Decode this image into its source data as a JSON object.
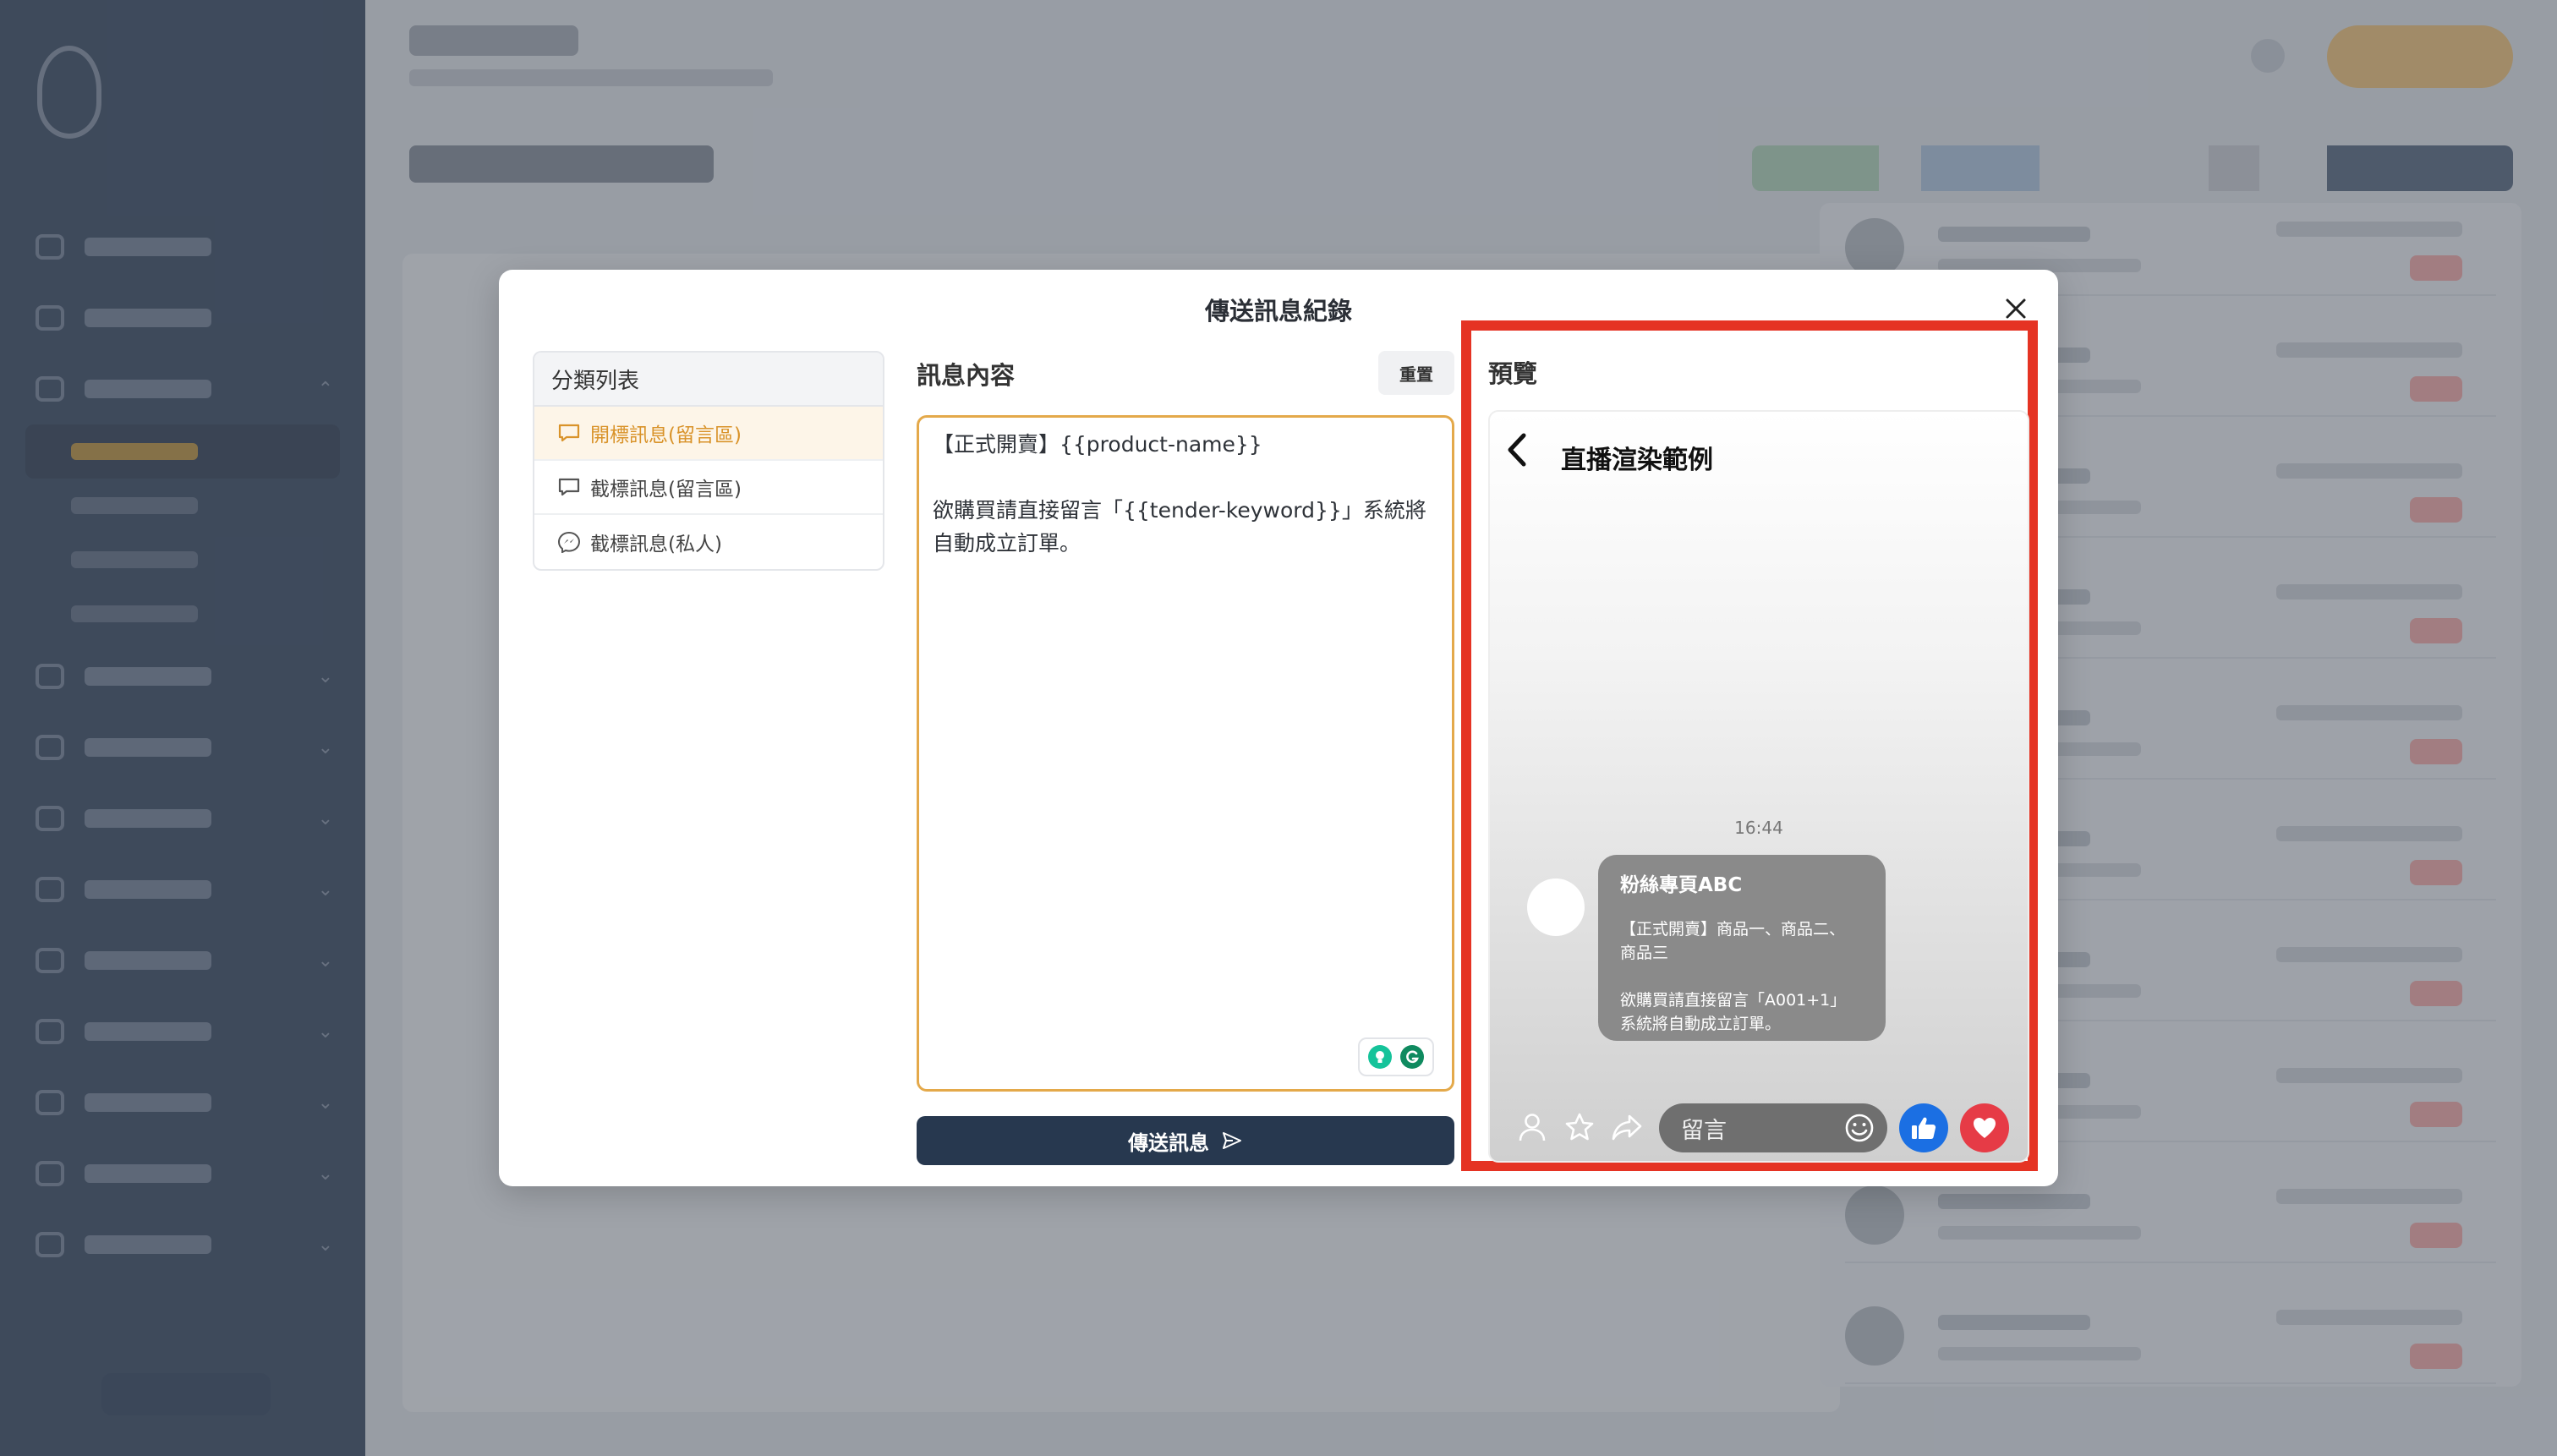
{
  "modal": {
    "title": "傳送訊息紀錄",
    "close_icon": "close-icon"
  },
  "categories": {
    "header": "分類列表",
    "items": [
      {
        "label": "開標訊息(留言區)",
        "icon": "comment-icon",
        "active": true
      },
      {
        "label": "截標訊息(留言區)",
        "icon": "comment-icon",
        "active": false
      },
      {
        "label": "截標訊息(私人)",
        "icon": "messenger-icon",
        "active": false
      }
    ]
  },
  "editor": {
    "label": "訊息內容",
    "reset_label": "重置",
    "content": "【正式開賣】{{product-name}}\n\n欲購買請直接留言「{{tender-keyword}}」系統將自動成立訂單。",
    "send_label": "傳送訊息",
    "send_icon": "send-icon"
  },
  "preview": {
    "label": "預覽",
    "header_title": "直播渲染範例",
    "time": "16:44",
    "bubble": {
      "sender": "粉絲專頁ABC",
      "text": "【正式開賣】商品一、商品二、\n商品三\n\n欲購買請直接留言「A001+1」\n系統將自動成立訂單。"
    },
    "comment_placeholder": "留言",
    "accent_frame_color": "#e53323"
  },
  "colors": {
    "primary": "#27384f",
    "accent": "#d9932a",
    "like": "#1b6fe3",
    "heart": "#e63b46"
  }
}
